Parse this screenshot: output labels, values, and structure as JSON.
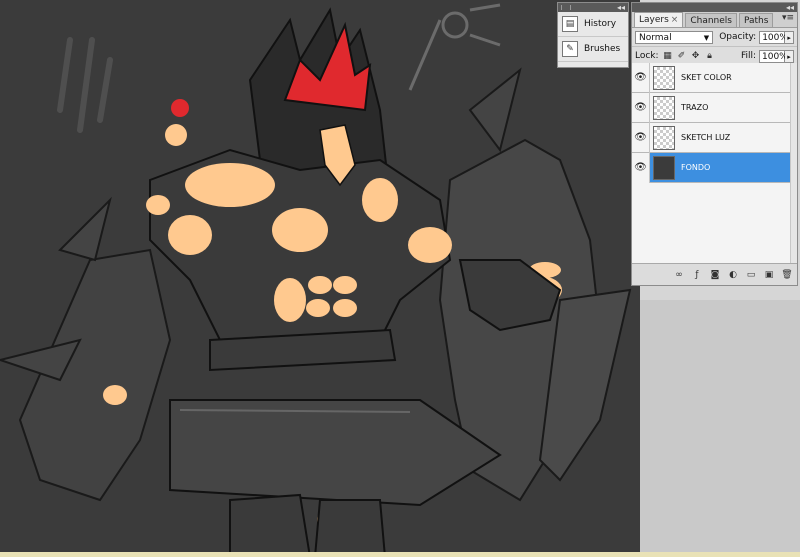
{
  "mini_panel": {
    "items": [
      {
        "label": "History",
        "icon": "history-icon"
      },
      {
        "label": "Brushes",
        "icon": "brushes-icon"
      }
    ]
  },
  "layers_panel": {
    "tabs": [
      {
        "label": "Layers",
        "active": true
      },
      {
        "label": "Channels",
        "active": false
      },
      {
        "label": "Paths",
        "active": false
      }
    ],
    "blend_mode": "Normal",
    "opacity_label": "Opacity:",
    "opacity_value": "100%",
    "lock_label": "Lock:",
    "fill_label": "Fill:",
    "fill_value": "100%",
    "layers": [
      {
        "name": "SKET COLOR",
        "selected": false,
        "visible": true
      },
      {
        "name": "TRAZO",
        "selected": false,
        "visible": true
      },
      {
        "name": "SKETCH LUZ",
        "selected": false,
        "visible": true
      },
      {
        "name": "FONDO",
        "selected": true,
        "visible": true
      }
    ]
  },
  "colors": {
    "canvas_bg": "#3b3b3b",
    "selection": "#3d8fe0",
    "skin": "#ffc98f",
    "crown": "#e0292e"
  }
}
